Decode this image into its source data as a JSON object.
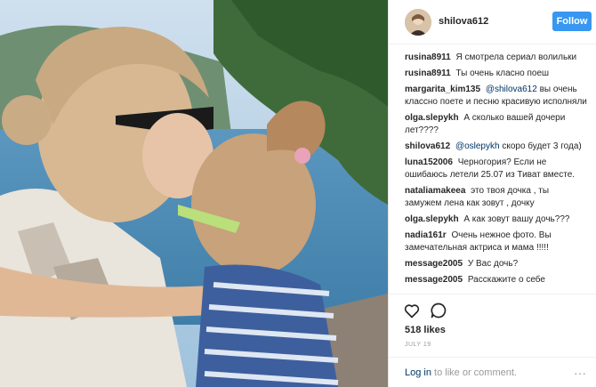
{
  "post": {
    "photo_icon": "photo-mother-and-daughter"
  },
  "header": {
    "username": "shilova612",
    "follow_label": "Follow"
  },
  "comments": [
    {
      "user": "rusina8911",
      "text": "Я смотрела сериал волильки"
    },
    {
      "user": "rusina8911",
      "text": "Ты очень класно поеш"
    },
    {
      "user": "margarita_kim135",
      "mention": "@shilova612",
      "text": "вы очень классно поете и песню красивую исполняли"
    },
    {
      "user": "olga.slepykh",
      "text": "А сколько вашей дочери лет????"
    },
    {
      "user": "shilova612",
      "mention": "@oslepykh",
      "text": "скоро будет 3 года)"
    },
    {
      "user": "luna152006",
      "text": "Черногория? Если не ошибаюсь летели 25.07 из Тиват вместе."
    },
    {
      "user": "nataliamakeea",
      "text": "это твоя дочка , ты замужем лена как зовут , дочку"
    },
    {
      "user": "olga.slepykh",
      "text": "А как зовут вашу дочь???"
    },
    {
      "user": "nadia161r",
      "text": "Очень нежное фото. Вы замечательная актриса и мама !!!!!"
    },
    {
      "user": "message2005",
      "text": "У Вас дочь?"
    },
    {
      "user": "message2005",
      "text": "Расскажите о себе"
    }
  ],
  "actions": {
    "likes": "518 likes",
    "date": "JULY 19",
    "login_link": "Log in",
    "login_rest": "to like or comment.",
    "more_glyph": "···"
  },
  "colors": {
    "follow": "#3897f0",
    "link": "#003569",
    "muted": "#999999"
  }
}
